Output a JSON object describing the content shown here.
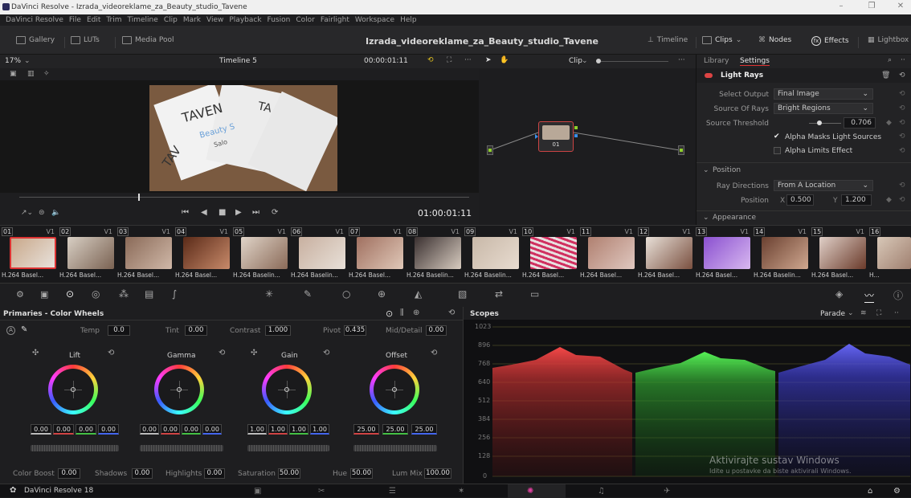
{
  "window": {
    "title": "DaVinci Resolve - Izrada_videoreklame_za_Beauty_studio_Tavene"
  },
  "menu": [
    "DaVinci Resolve",
    "File",
    "Edit",
    "Trim",
    "Timeline",
    "Clip",
    "Mark",
    "View",
    "Playback",
    "Fusion",
    "Color",
    "Fairlight",
    "Workspace",
    "Help"
  ],
  "toolbar": {
    "gallery": "Gallery",
    "luts": "LUTs",
    "media_pool": "Media Pool",
    "project": "Izrada_videoreklame_za_Beauty_studio_Tavene",
    "timeline": "Timeline",
    "clips": "Clips",
    "nodes": "Nodes",
    "effects": "Effects",
    "lightbox": "Lightbox"
  },
  "viewer": {
    "zoom": "17%",
    "timeline_name": "Timeline 5",
    "timecode_top": "00:00:01:11",
    "timecode": "01:00:01:11",
    "clip_mode": "Clip"
  },
  "frame_text": {
    "a": "TAVEN",
    "b": "TAV",
    "c": "Beauty S",
    "d": "Salo",
    "e": "TA"
  },
  "node": {
    "label": "01"
  },
  "settings": {
    "tabs": [
      "Library",
      "Settings"
    ],
    "effect": "Light Rays",
    "select_output_label": "Select Output",
    "select_output": "Final Image",
    "source_rays_label": "Source Of Rays",
    "source_rays": "Bright Regions",
    "threshold_label": "Source Threshold",
    "threshold": "0.706",
    "alpha_masks": "Alpha Masks Light Sources",
    "alpha_limits": "Alpha Limits Effect",
    "position_section": "Position",
    "ray_dir_label": "Ray Directions",
    "ray_dir": "From A Location",
    "position_label": "Position",
    "x_label": "X",
    "x": "0.500",
    "y_label": "Y",
    "y": "1.200",
    "appearance_section": "Appearance"
  },
  "clips": [
    {
      "num": "01",
      "trk": "V1",
      "cap": "H.264 Basel..."
    },
    {
      "num": "02",
      "trk": "V1",
      "cap": "H.264 Basel..."
    },
    {
      "num": "03",
      "trk": "V1",
      "cap": "H.264 Basel..."
    },
    {
      "num": "04",
      "trk": "V1",
      "cap": "H.264 Basel..."
    },
    {
      "num": "05",
      "trk": "V1",
      "cap": "H.264 Baselin..."
    },
    {
      "num": "06",
      "trk": "V1",
      "cap": "H.264 Baselin..."
    },
    {
      "num": "07",
      "trk": "V1",
      "cap": "H.264 Basel..."
    },
    {
      "num": "08",
      "trk": "V1",
      "cap": "H.264 Baselin..."
    },
    {
      "num": "09",
      "trk": "V1",
      "cap": "H.264 Baselin..."
    },
    {
      "num": "10",
      "trk": "V1",
      "cap": "H.264 Basel..."
    },
    {
      "num": "11",
      "trk": "V1",
      "cap": "H.264 Basel..."
    },
    {
      "num": "12",
      "trk": "V1",
      "cap": "H.264 Basel..."
    },
    {
      "num": "13",
      "trk": "V1",
      "cap": "H.264 Basel..."
    },
    {
      "num": "14",
      "trk": "V1",
      "cap": "H.264 Baselin..."
    },
    {
      "num": "15",
      "trk": "V1",
      "cap": "H.264 Basel..."
    },
    {
      "num": "16",
      "trk": "",
      "cap": "H..."
    }
  ],
  "primaries": {
    "title": "Primaries - Color Wheels",
    "temp_label": "Temp",
    "temp": "0.0",
    "tint_label": "Tint",
    "tint": "0.00",
    "contrast_label": "Contrast",
    "contrast": "1.000",
    "pivot_label": "Pivot",
    "pivot": "0.435",
    "middetail_label": "Mid/Detail",
    "middetail": "0.00",
    "lift": {
      "name": "Lift",
      "y": "0.00",
      "r": "0.00",
      "g": "0.00",
      "b": "0.00"
    },
    "gamma": {
      "name": "Gamma",
      "y": "0.00",
      "r": "0.00",
      "g": "0.00",
      "b": "0.00"
    },
    "gain": {
      "name": "Gain",
      "y": "1.00",
      "r": "1.00",
      "g": "1.00",
      "b": "1.00"
    },
    "offset": {
      "name": "Offset",
      "r": "25.00",
      "g": "25.00",
      "b": "25.00"
    },
    "boost_label": "Color Boost",
    "boost": "0.00",
    "shadows_label": "Shadows",
    "shadows": "0.00",
    "highlights_label": "Highlights",
    "highlights": "0.00",
    "saturation_label": "Saturation",
    "saturation": "50.00",
    "hue_label": "Hue",
    "hue": "50.00",
    "lummix_label": "Lum Mix",
    "lummix": "100.00"
  },
  "scopes": {
    "title": "Scopes",
    "mode": "Parade",
    "ticks": [
      "1023",
      "896",
      "768",
      "640",
      "512",
      "384",
      "256",
      "128",
      "0"
    ]
  },
  "watermark": {
    "line1": "Aktivirajte sustav Windows",
    "line2": "Idite u postavke da biste aktivirali Windows."
  },
  "bottom": {
    "app": "DaVinci Resolve 18"
  }
}
